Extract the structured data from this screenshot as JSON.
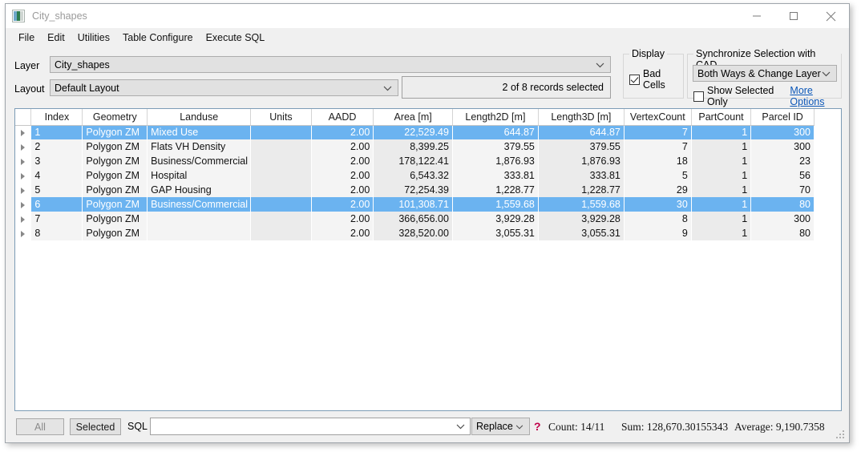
{
  "window": {
    "title": "City_shapes",
    "icon": "app-icon",
    "controls": {
      "minimize": "minimize-icon",
      "maximize": "maximize-icon",
      "close": "close-icon"
    }
  },
  "menubar": {
    "items": [
      "File",
      "Edit",
      "Utilities",
      "Table Configure",
      "Execute SQL"
    ]
  },
  "toolbar": {
    "layer_label": "Layer",
    "layer_value": "City_shapes",
    "layout_label": "Layout",
    "layout_value": "Default Layout",
    "records_status": "2 of 8 records selected",
    "display_group": "Display",
    "bad_cells_label": "Bad Cells",
    "bad_cells_checked": true,
    "sync_group": "Synchronize Selection with CAD",
    "sync_value": "Both Ways & Change Layer",
    "show_selected_only_label": "Show Selected Only",
    "show_selected_only_checked": false,
    "more_options_label": "More Options"
  },
  "table": {
    "columns": [
      "Index",
      "Geometry",
      "Landuse",
      "Units",
      "AADD",
      "Area [m]",
      "Length2D [m]",
      "Length3D [m]",
      "VertexCount",
      "PartCount",
      "Parcel ID"
    ],
    "rows": [
      {
        "selected": true,
        "cells": [
          "1",
          "Polygon ZM",
          "Mixed Use",
          "",
          "2.00",
          "22,529.49",
          "644.87",
          "644.87",
          "7",
          "1",
          "300"
        ]
      },
      {
        "selected": false,
        "cells": [
          "2",
          "Polygon ZM",
          "Flats VH Density",
          "",
          "2.00",
          "8,399.25",
          "379.55",
          "379.55",
          "7",
          "1",
          "300"
        ]
      },
      {
        "selected": false,
        "cells": [
          "3",
          "Polygon ZM",
          "Business/Commercial",
          "",
          "2.00",
          "178,122.41",
          "1,876.93",
          "1,876.93",
          "18",
          "1",
          "23"
        ]
      },
      {
        "selected": false,
        "cells": [
          "4",
          "Polygon ZM",
          "Hospital",
          "",
          "2.00",
          "6,543.32",
          "333.81",
          "333.81",
          "5",
          "1",
          "56"
        ]
      },
      {
        "selected": false,
        "cells": [
          "5",
          "Polygon ZM",
          "GAP Housing",
          "",
          "2.00",
          "72,254.39",
          "1,228.77",
          "1,228.77",
          "29",
          "1",
          "70"
        ]
      },
      {
        "selected": true,
        "cells": [
          "6",
          "Polygon ZM",
          "Business/Commercial",
          "",
          "2.00",
          "101,308.71",
          "1,559.68",
          "1,559.68",
          "30",
          "1",
          "80"
        ]
      },
      {
        "selected": false,
        "cells": [
          "7",
          "Polygon ZM",
          "",
          "",
          "2.00",
          "366,656.00",
          "3,929.28",
          "3,929.28",
          "8",
          "1",
          "300"
        ]
      },
      {
        "selected": false,
        "cells": [
          "8",
          "Polygon ZM",
          "",
          "",
          "2.00",
          "328,520.00",
          "3,055.31",
          "3,055.31",
          "9",
          "1",
          "80"
        ]
      }
    ]
  },
  "bottom": {
    "all_button": "All",
    "selected_button": "Selected",
    "sql_label": "SQL",
    "sql_value": "",
    "mode_value": "Replace",
    "help_glyph": "?",
    "count_text": "Count: 14/11",
    "sum_text": "Sum: 128,670.30155343",
    "average_text": "Average: 9,190.7358"
  },
  "colors": {
    "selection": "#6bb3f0",
    "link": "#0b57b8",
    "frame": "#7c9cb6",
    "chrome": "#f0f0f0"
  }
}
